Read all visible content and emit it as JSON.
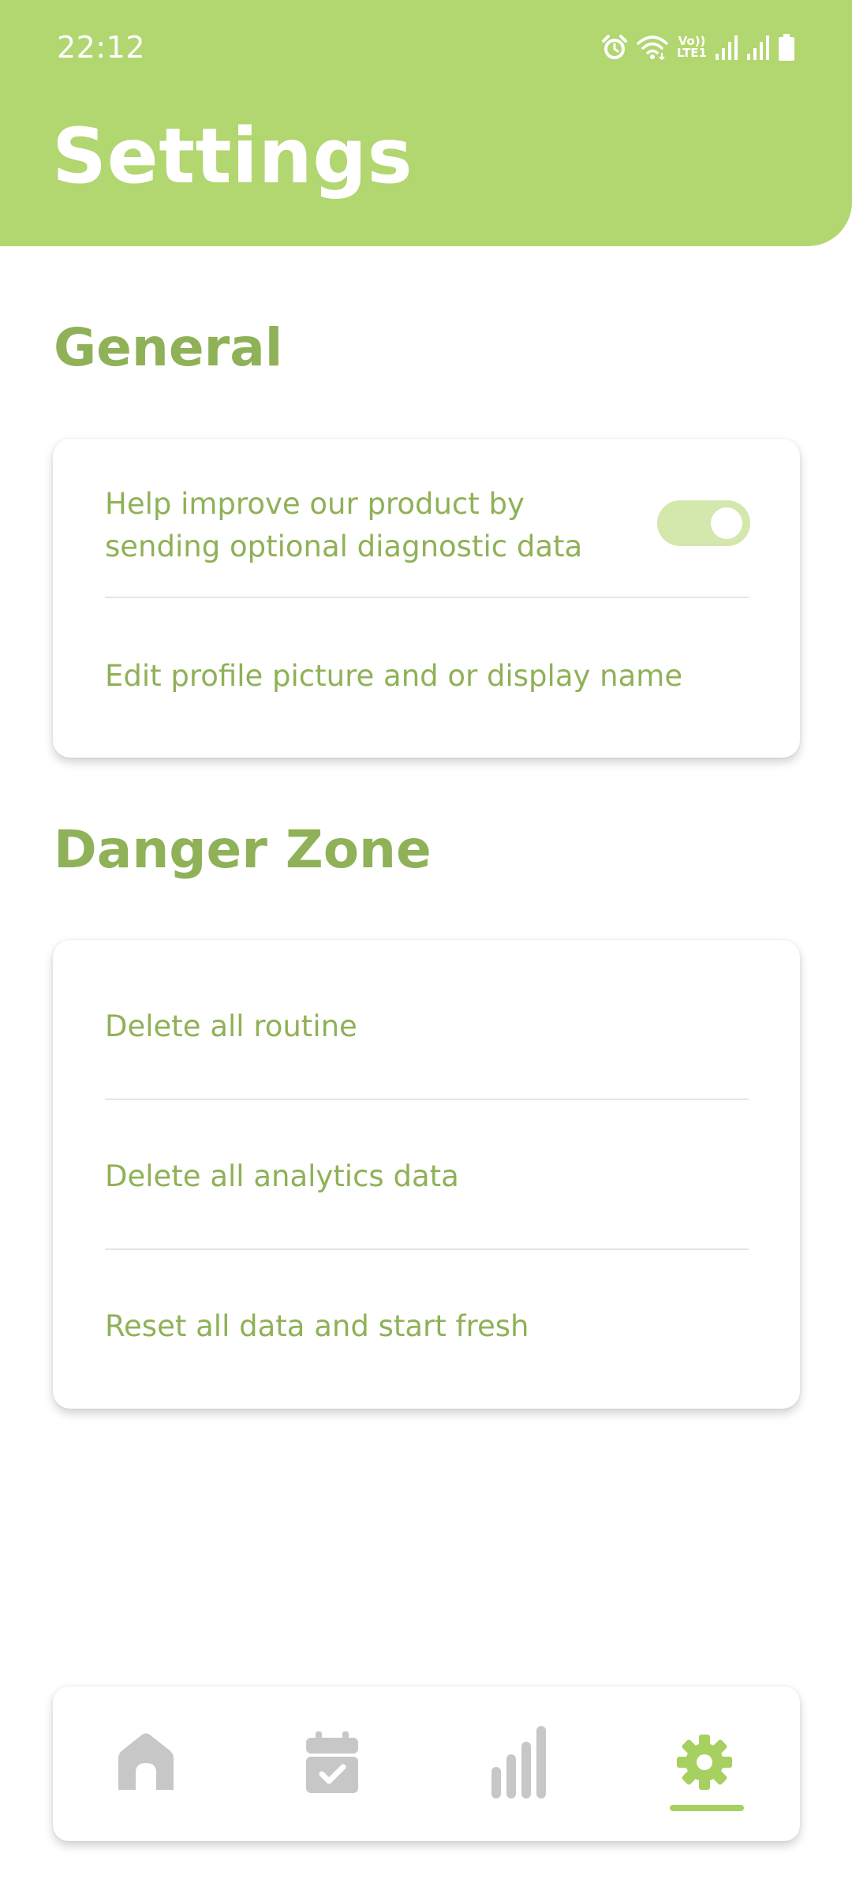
{
  "status_bar": {
    "time": "22:12",
    "icons": [
      "alarm-icon",
      "wifi-icon",
      "volte-icon",
      "signal-icon",
      "signal-icon",
      "battery-icon"
    ],
    "volte_label_top": "Vo))",
    "volte_label_bottom": "LTE1"
  },
  "header": {
    "title": "Settings",
    "background_color": "#b2d670"
  },
  "general": {
    "title": "General",
    "diagnostics_label": "Help improve our product by sending optional diagnostic data",
    "diagnostics_enabled": true,
    "edit_profile_label": "Edit profile picture and or display name"
  },
  "danger_zone": {
    "title": "Danger Zone",
    "items": [
      {
        "label": "Delete all routine"
      },
      {
        "label": "Delete all analytics data"
      },
      {
        "label": "Reset all data and start fresh"
      }
    ]
  },
  "bottom_nav": {
    "items": [
      {
        "icon": "home-icon",
        "active": false
      },
      {
        "icon": "calendar-check-icon",
        "active": false
      },
      {
        "icon": "bar-chart-icon",
        "active": false
      },
      {
        "icon": "gear-icon",
        "active": true
      }
    ],
    "active_color": "#a6d060",
    "inactive_color": "#c7c7c7"
  },
  "colors": {
    "accent": "#8fb157",
    "header": "#b2d670",
    "toggle_track": "#d4e7ac"
  }
}
